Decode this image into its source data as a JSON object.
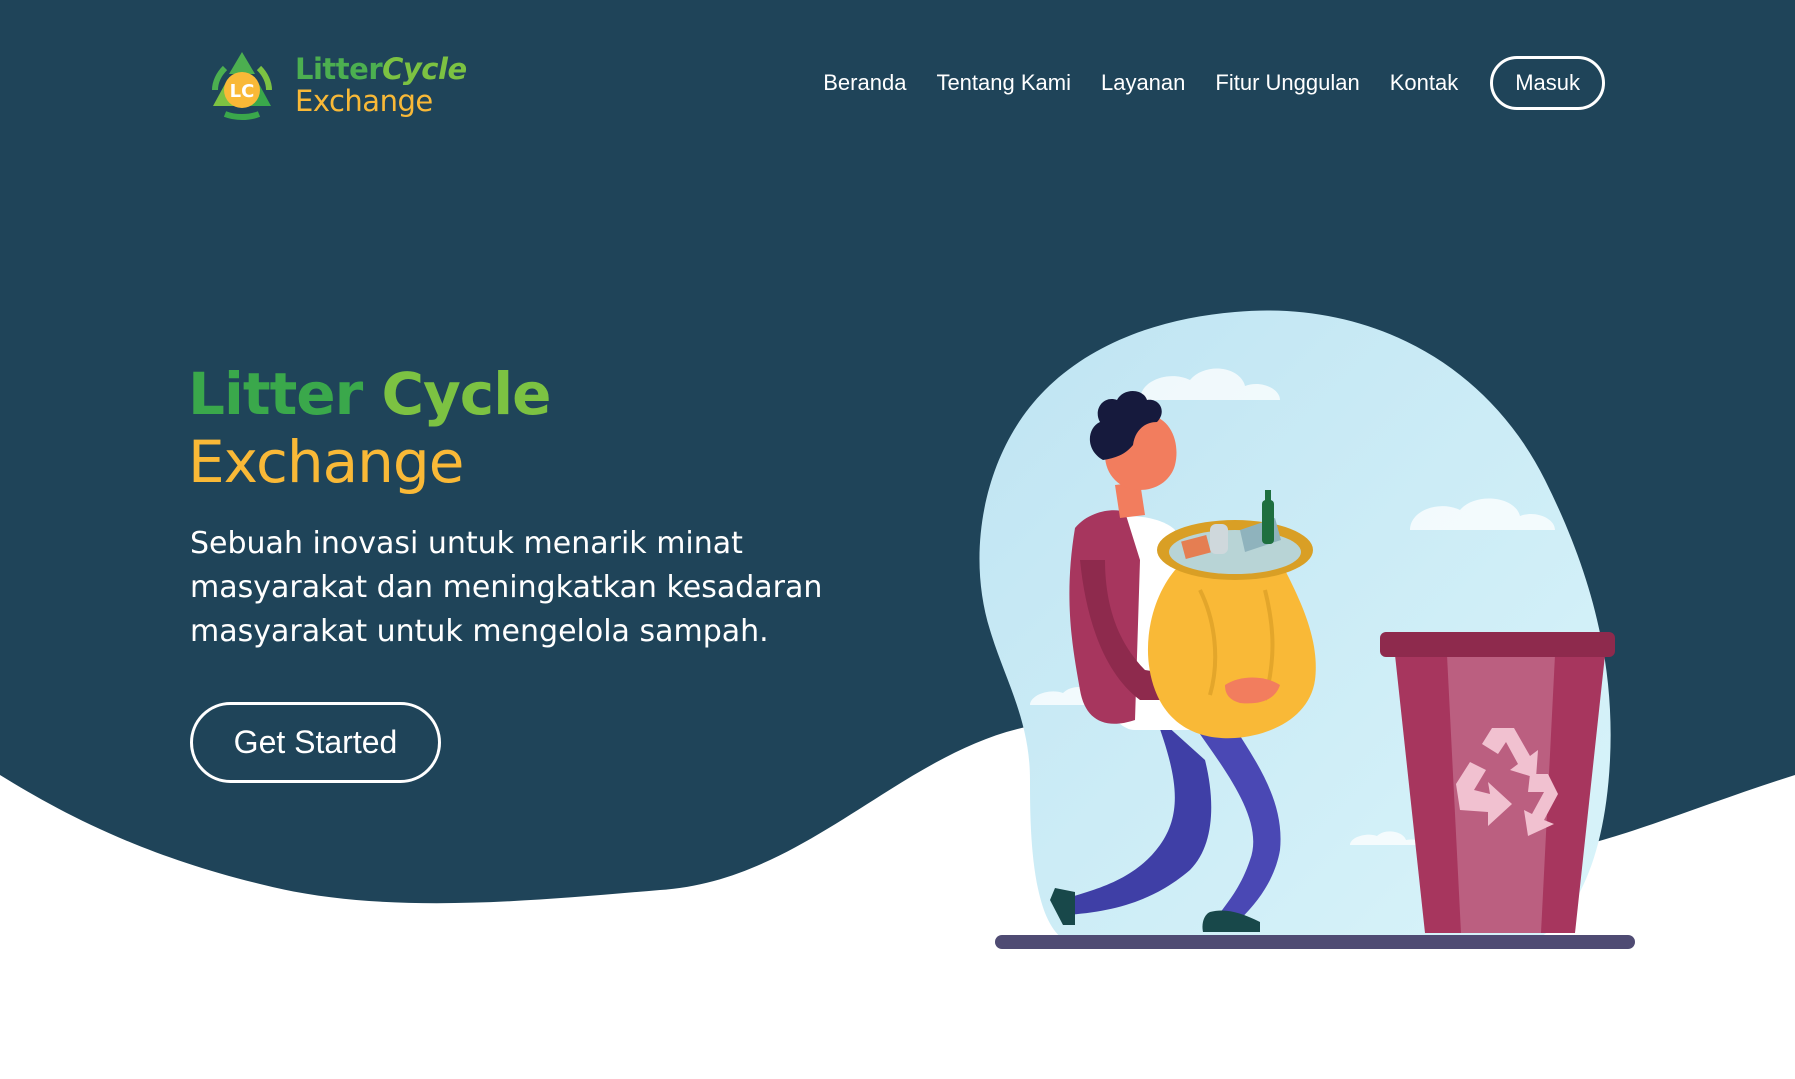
{
  "brand": {
    "logo_badge": "LC",
    "name_part1": "Litter",
    "name_part2": "Cycle",
    "name_part3": "Exchange"
  },
  "nav": {
    "items": [
      {
        "label": "Beranda"
      },
      {
        "label": "Tentang Kami"
      },
      {
        "label": "Layanan"
      },
      {
        "label": "Fitur Unggulan"
      },
      {
        "label": "Kontak"
      }
    ],
    "login_label": "Masuk"
  },
  "hero": {
    "title_word1": "Litter",
    "title_word2": "Cycle",
    "title_word3": "Exchange",
    "description": "Sebuah inovasi untuk menarik minat masyarakat dan meningkatkan kesadaran masyarakat untuk mengelola sampah.",
    "cta_label": "Get Started"
  },
  "colors": {
    "hero_background": "#1f4459",
    "brand_green": "#3aa84b",
    "brand_light_green": "#7cc242",
    "brand_yellow": "#f9b937",
    "bin_color": "#a7365e"
  },
  "icons": {
    "logo": "recycle-logo-icon",
    "bin_symbol": "recycle-icon"
  }
}
